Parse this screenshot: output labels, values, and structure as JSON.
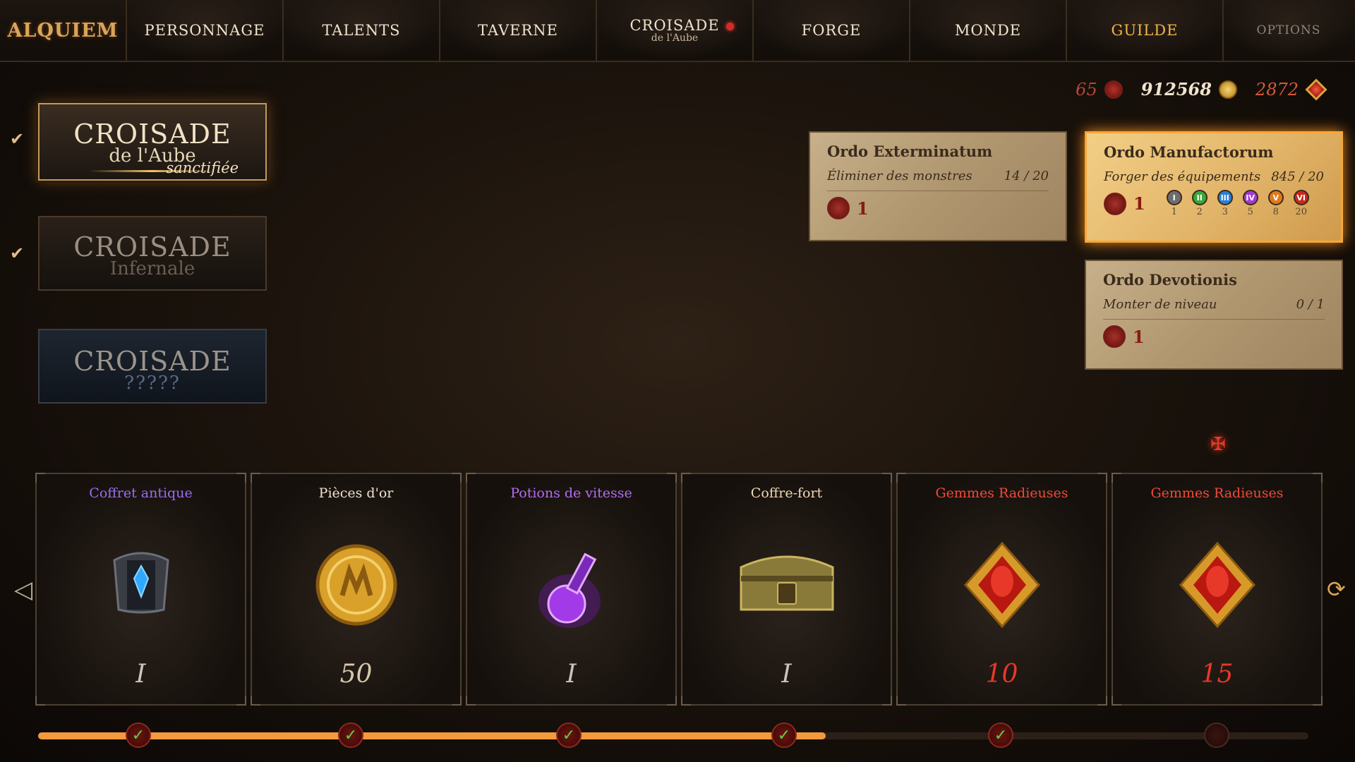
{
  "app": {
    "logo": "ALQUIEM"
  },
  "nav": {
    "tabs": [
      {
        "label": "PERSONNAGE",
        "sub": ""
      },
      {
        "label": "TALENTS",
        "sub": ""
      },
      {
        "label": "TAVERNE",
        "sub": ""
      },
      {
        "label": "CROISADE",
        "sub": "de l'Aube",
        "notification": true
      },
      {
        "label": "FORGE",
        "sub": ""
      },
      {
        "label": "MONDE",
        "sub": ""
      },
      {
        "label": "GUILDE",
        "sub": ""
      },
      {
        "label": "OPTIONS",
        "sub": ""
      }
    ],
    "colors": {
      "guild": "#f0b44a",
      "notification": "#d52b25"
    }
  },
  "currency": {
    "seals": "65",
    "gold": "912568",
    "gems": "2872"
  },
  "crusades": [
    {
      "title": "CROISADE",
      "subtitle": "de l'Aube",
      "tag": "sanctifiée",
      "checked": true,
      "selected": true
    },
    {
      "title": "CROISADE",
      "subtitle": "Infernale",
      "tag": "",
      "checked": true,
      "selected": false
    },
    {
      "title": "CROISADE",
      "subtitle": "?????",
      "tag": "",
      "checked": false,
      "selected": false
    }
  ],
  "quests": [
    {
      "title": "Ordo Exterminatum",
      "task": "Éliminer des monstres",
      "progress": "14 / 20",
      "reward": "1"
    },
    {
      "title": "Ordo Manufactorum",
      "task": "Forger des équipements",
      "progress": "845 / 20",
      "reward": "1",
      "tiers": [
        {
          "roman": "I",
          "value": "1",
          "color": "#6d6d6d"
        },
        {
          "roman": "II",
          "value": "2",
          "color": "#3aa83a"
        },
        {
          "roman": "III",
          "value": "3",
          "color": "#2a7fd4"
        },
        {
          "roman": "IV",
          "value": "5",
          "color": "#a33ad4"
        },
        {
          "roman": "V",
          "value": "8",
          "color": "#e07a1c"
        },
        {
          "roman": "VI",
          "value": "20",
          "color": "#c8281c"
        }
      ]
    },
    {
      "title": "Ordo Devotionis",
      "task": "Monter de niveau",
      "progress": "0 / 1",
      "reward": "1"
    }
  ],
  "rewards": [
    {
      "name": "Coffret antique",
      "qty": "I",
      "color": "#9b6cf2",
      "icon": "antique-chest-icon"
    },
    {
      "name": "Pièces d'or",
      "qty": "50",
      "color": "#efe3cd",
      "icon": "gold-coin-icon"
    },
    {
      "name": "Potions de vitesse",
      "qty": "I",
      "color": "#b36cf2",
      "icon": "speed-potion-icon"
    },
    {
      "name": "Coffre-fort",
      "qty": "I",
      "color": "#f0d9b5",
      "icon": "safe-chest-icon"
    },
    {
      "name": "Gemmes Radieuses",
      "qty": "10",
      "color": "#ef4a3a",
      "icon": "radiant-gem-icon"
    },
    {
      "name": "Gemmes Radieuses",
      "qty": "15",
      "color": "#ef4a3a",
      "icon": "radiant-gem-icon"
    }
  ],
  "progress": {
    "fraction": 0.62,
    "milestones": [
      {
        "done": true
      },
      {
        "done": true
      },
      {
        "done": true
      },
      {
        "done": true
      },
      {
        "done": true
      },
      {
        "done": false
      }
    ]
  }
}
